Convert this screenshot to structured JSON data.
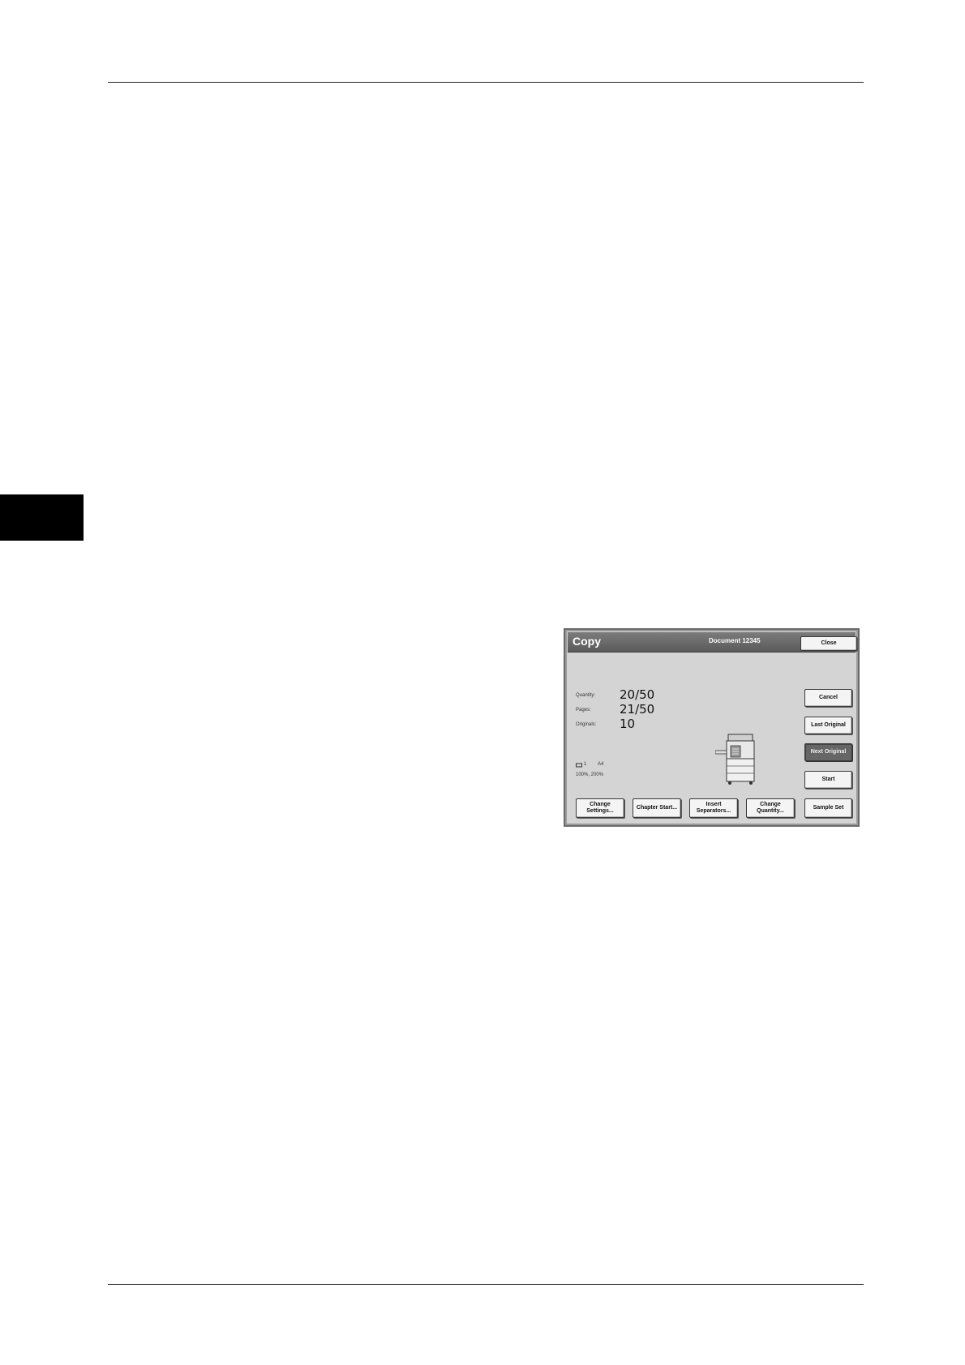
{
  "screen": {
    "title": "Copy",
    "document_name": "Document 12345",
    "close_label": "Close",
    "status": {
      "quantity_label": "Quantity:",
      "quantity_value": "20/50",
      "pages_label": "Pages:",
      "pages_value": "21/50",
      "originals_label": "Originals:",
      "originals_value": "10"
    },
    "tray_info": "1",
    "paper_size": "A4",
    "ratio": "100%, 200%",
    "side_buttons": {
      "cancel": "Cancel",
      "last_original": "Last Original",
      "next_original": "Next Original",
      "start": "Start"
    },
    "bottom_buttons": {
      "change_settings": "Change Settings...",
      "chapter_start": "Chapter Start...",
      "insert_separators": "Insert Separators...",
      "change_quantity": "Change Quantity...",
      "sample_set": "Sample Set"
    }
  },
  "icons": [
    "tray-icon",
    "printer-machine-icon"
  ]
}
